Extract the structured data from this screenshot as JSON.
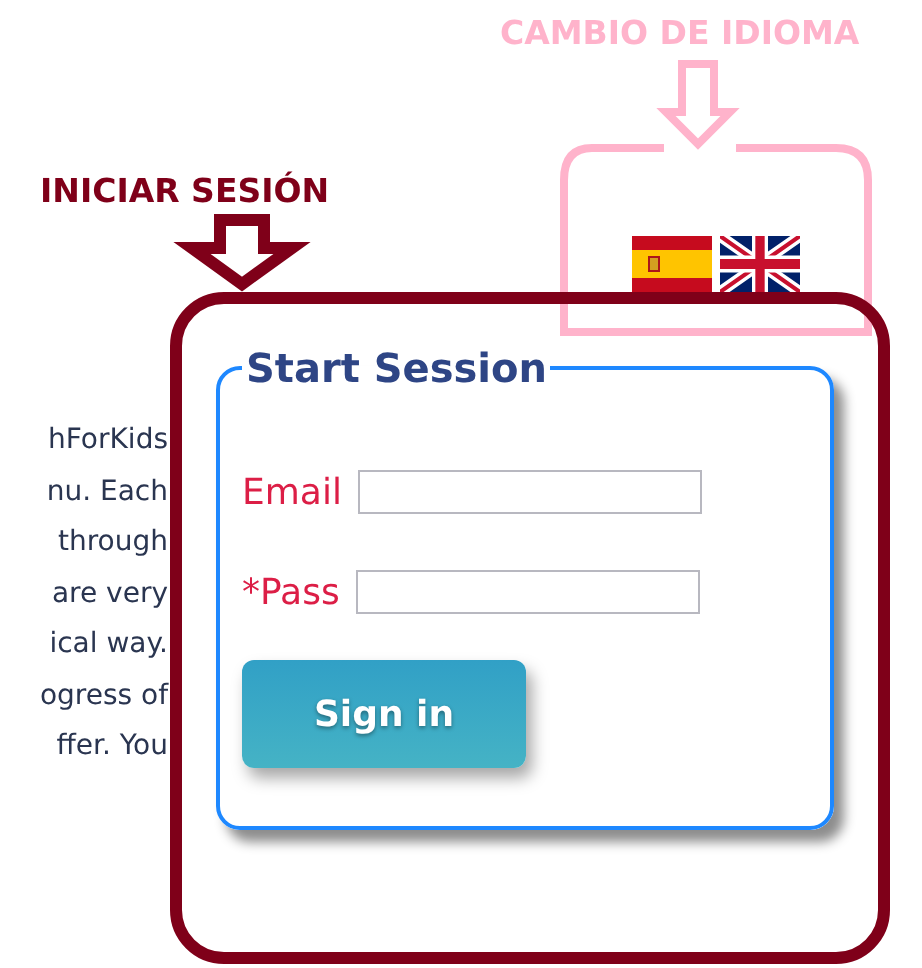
{
  "annotations": [
    {
      "label": "CAMBIO DE IDIOMA",
      "color": "#ffb3cb"
    },
    {
      "label": "INICIAR SESIÓN",
      "color": "#7f0019"
    }
  ],
  "intro_lines": [
    "hForKids",
    "nu. Each",
    " through",
    " are very",
    "ical way.",
    "ogress of",
    "ffer. You"
  ],
  "login": {
    "legend": "Start Session",
    "fields": [
      {
        "label": "Email"
      },
      {
        "label": "*Pass"
      }
    ],
    "button": "Sign in"
  }
}
